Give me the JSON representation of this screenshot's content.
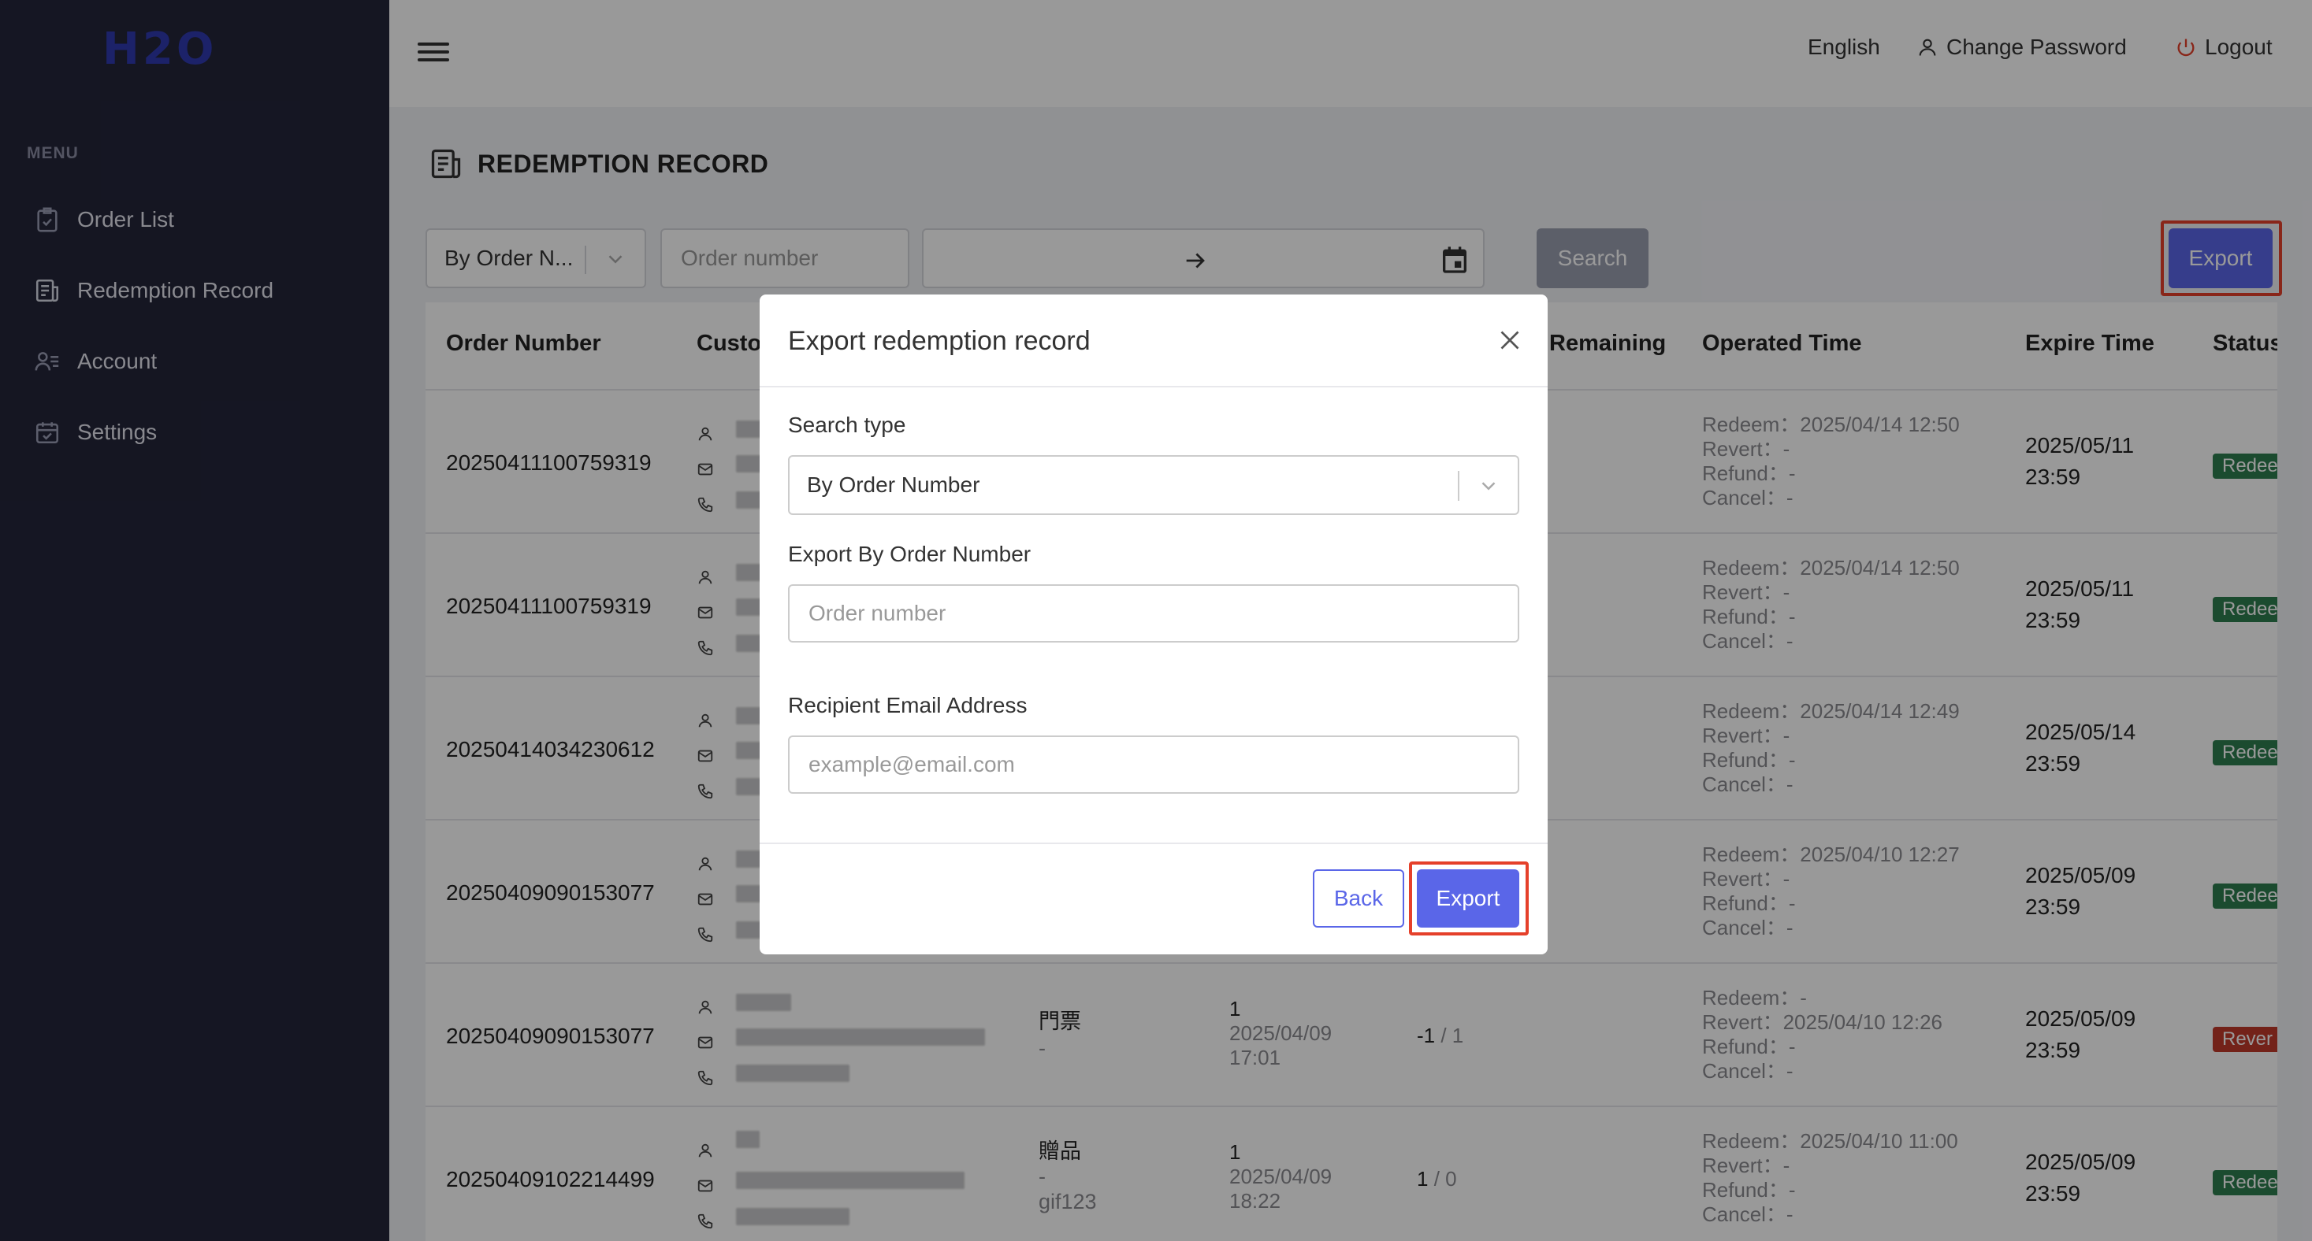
{
  "app": {
    "logo_text": "H2O"
  },
  "sidebar": {
    "caption": "MENU",
    "items": [
      {
        "label": "Order List",
        "icon": "clipboard-check-icon"
      },
      {
        "label": "Redemption Record",
        "icon": "receipt-icon"
      },
      {
        "label": "Account",
        "icon": "user-list-icon"
      },
      {
        "label": "Settings",
        "icon": "calendar-check-icon"
      }
    ]
  },
  "header": {
    "language": "English",
    "change_password": "Change Password",
    "logout": "Logout"
  },
  "page": {
    "title": "REDEMPTION RECORD"
  },
  "filters": {
    "search_type": "By Order N...",
    "order_placeholder": "Order number",
    "search_label": "Search",
    "export_label": "Export"
  },
  "table": {
    "columns": [
      "Order Number",
      "Custo",
      "Remaining",
      "Operated Time",
      "Expire Time",
      "Status"
    ],
    "rows": [
      {
        "order": "20250411100759319",
        "product": "",
        "product_sub": "",
        "product_code": "",
        "qty": "",
        "date": "",
        "time": "",
        "remaining": "",
        "remaining_total": "",
        "ops": [
          "Redeem：2025/04/14 12:50",
          "Revert：-",
          "Refund：-",
          "Cancel：-"
        ],
        "exp_date": "2025/05/11",
        "exp_time": "23:59",
        "status": "Redee"
      },
      {
        "order": "20250411100759319",
        "product": "",
        "product_sub": "",
        "product_code": "",
        "qty": "",
        "date": "",
        "time": "",
        "remaining": "",
        "remaining_total": "",
        "ops": [
          "Redeem：2025/04/14 12:50",
          "Revert：-",
          "Refund：-",
          "Cancel：-"
        ],
        "exp_date": "2025/05/11",
        "exp_time": "23:59",
        "status": "Redee"
      },
      {
        "order": "20250414034230612",
        "product": "",
        "product_sub": "",
        "product_code": "",
        "qty": "",
        "date": "",
        "time": "",
        "remaining": "",
        "remaining_total": "",
        "ops": [
          "Redeem：2025/04/14 12:49",
          "Revert：-",
          "Refund：-",
          "Cancel：-"
        ],
        "exp_date": "2025/05/14",
        "exp_time": "23:59",
        "status": "Redee"
      },
      {
        "order": "20250409090153077",
        "product": "",
        "product_sub": "",
        "product_code": "",
        "qty": "",
        "date": "",
        "time": "",
        "remaining": "",
        "remaining_total": "",
        "ops": [
          "Redeem：2025/04/10 12:27",
          "Revert：-",
          "Refund：-",
          "Cancel：-"
        ],
        "exp_date": "2025/05/09",
        "exp_time": "23:59",
        "status": "Redee"
      },
      {
        "order": "20250409090153077",
        "product": "門票",
        "product_sub": "-",
        "product_code": "",
        "qty": "1",
        "date": "2025/04/09",
        "time": "17:01",
        "remaining": "-1",
        "remaining_total": " / 1",
        "ops": [
          "Redeem：-",
          "Revert：2025/04/10 12:26",
          "Refund：-",
          "Cancel：-"
        ],
        "exp_date": "2025/05/09",
        "exp_time": "23:59",
        "status": "Rever"
      },
      {
        "order": "20250409102214499",
        "product": "贈品",
        "product_sub": "-",
        "product_code": "gif123",
        "qty": "1",
        "date": "2025/04/09",
        "time": "18:22",
        "remaining": "1",
        "remaining_total": " / 0",
        "ops": [
          "Redeem：2025/04/10 11:00",
          "Revert：-",
          "Refund：-",
          "Cancel：-"
        ],
        "exp_date": "2025/05/09",
        "exp_time": "23:59",
        "status": "Redee"
      }
    ]
  },
  "modal": {
    "title": "Export redemption record",
    "search_type_label": "Search type",
    "search_type_value": "By Order Number",
    "order_label": "Export By Order Number",
    "order_placeholder": "Order number",
    "email_label": "Recipient Email Address",
    "email_placeholder": "example@email.com",
    "back_label": "Back",
    "export_label": "Export"
  },
  "colors": {
    "accent": "#5a66e8",
    "sidebar": "#23253a",
    "highlight": "#e5402a",
    "redeemed": "#2e7d4f",
    "reverted": "#c0392b"
  }
}
